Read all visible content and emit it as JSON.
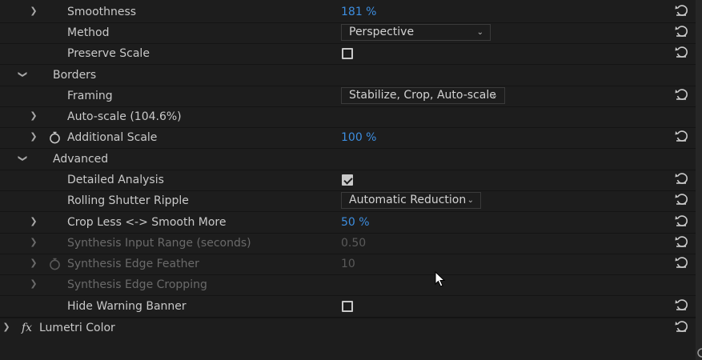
{
  "rows": {
    "smoothness": {
      "label": "Smoothness",
      "value": "181 %"
    },
    "method": {
      "label": "Method",
      "value": "Perspective"
    },
    "preserve_scale": {
      "label": "Preserve Scale"
    },
    "borders": {
      "label": "Borders"
    },
    "framing": {
      "label": "Framing",
      "value": "Stabilize, Crop, Auto-scale"
    },
    "auto_scale": {
      "label": "Auto-scale (104.6%)"
    },
    "additional_scale": {
      "label": "Additional Scale",
      "value": "100 %"
    },
    "advanced": {
      "label": "Advanced"
    },
    "detailed_analysis": {
      "label": "Detailed Analysis",
      "checked": true
    },
    "rolling_shutter": {
      "label": "Rolling Shutter Ripple",
      "value": "Automatic Reduction"
    },
    "crop_less": {
      "label": "Crop Less <-> Smooth More",
      "value": "50 %"
    },
    "synthesis_input": {
      "label": "Synthesis Input Range (seconds)",
      "value": "0.50"
    },
    "synthesis_feather": {
      "label": "Synthesis Edge Feather",
      "value": "10"
    },
    "synthesis_cropping": {
      "label": "Synthesis Edge Cropping"
    },
    "hide_warning": {
      "label": "Hide Warning Banner",
      "checked": false
    },
    "lumetri": {
      "fx": "fx",
      "label": "Lumetri Color"
    }
  },
  "icons": {
    "twirl": "chevron-icon",
    "reset": "reset-icon",
    "stopwatch": "stopwatch-icon"
  },
  "colors": {
    "background": "#1d1d1d",
    "value_blue": "#3d8ee0",
    "label": "#c9c9c9",
    "disabled": "#6a6a6a"
  }
}
